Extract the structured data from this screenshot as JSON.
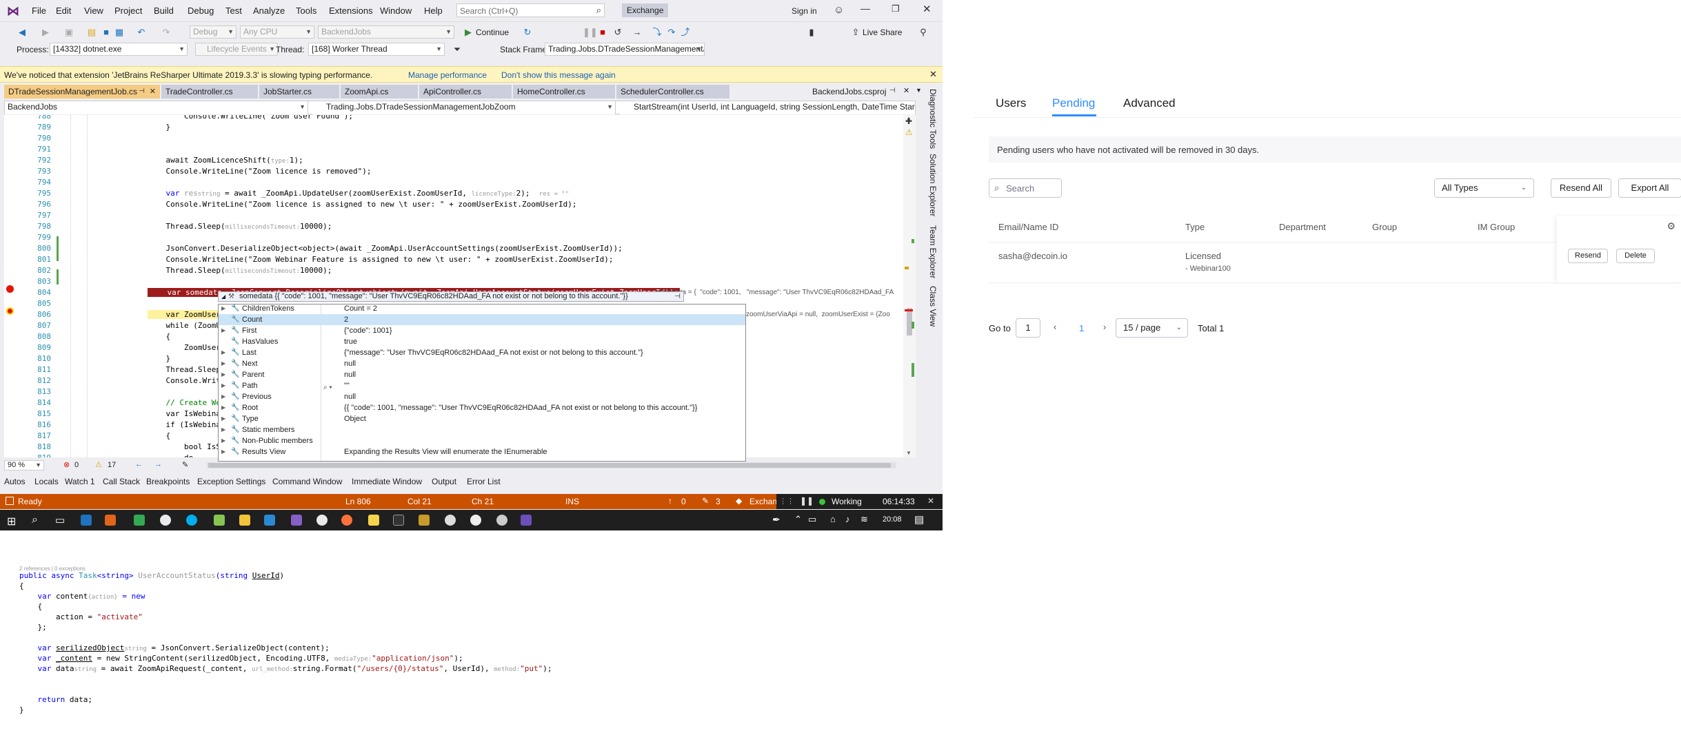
{
  "vs": {
    "menu": [
      "File",
      "Edit",
      "View",
      "Project",
      "Build",
      "Debug",
      "Test",
      "Analyze",
      "Tools",
      "Extensions",
      "Window",
      "Help"
    ],
    "search_placeholder": "Search (Ctrl+Q)",
    "solution_badge": "Exchange",
    "sign_in": "Sign in",
    "toolbar": {
      "config": "Debug",
      "platform": "Any CPU",
      "project": "BackendJobs",
      "continue": "Continue",
      "live_share": "Live Share"
    },
    "toolbar2": {
      "process_label": "Process:",
      "process_value": "[14332] dotnet.exe",
      "lifecycle": "Lifecycle Events",
      "thread_label": "Thread:",
      "thread_value": "[168] Worker Thread",
      "stackframe_label": "Stack Frame:",
      "stackframe_value": "Trading.Jobs.DTradeSessionManagementJ"
    },
    "infobar": {
      "message": "We've noticed that extension 'JetBrains ReSharper Ultimate 2019.3.3' is slowing typing performance.",
      "link1": "Manage performance",
      "link2": "Don't show this message again"
    },
    "tabs": [
      "DTradeSessionManagementJob.cs",
      "TradeController.cs",
      "JobStarter.cs",
      "ZoomApi.cs",
      "ApiController.cs",
      "HomeController.cs",
      "SchedulerController.cs",
      "BackendJobs.csproj"
    ],
    "nav": {
      "project": "BackendJobs",
      "class": "Trading.Jobs.DTradeSessionManagementJobZoom",
      "member": "StartStream(int UserId, int LanguageId, string SessionLength, DateTime StartTi"
    },
    "line_numbers": [
      "788",
      "789",
      "790",
      "791",
      "792",
      "793",
      "794",
      "795",
      "796",
      "797",
      "798",
      "799",
      "800",
      "801",
      "802",
      "803",
      "804",
      "805",
      "806",
      "807",
      "808",
      "809",
      "810",
      "811",
      "812",
      "813",
      "814",
      "815",
      "816",
      "817",
      "818",
      "819",
      "820"
    ],
    "code": {
      "l788": "        Console.WriteLine(\"Zoom user Found\");",
      "l789": "    }",
      "l792": "    await ZoomLicenceShift(",
      "l792_hint": "type:",
      "l792_end": "1);",
      "l793": "    Console.WriteLine(\"Zoom licence is removed\");",
      "l795a": "    var ",
      "l795b": "res",
      "l795_hint1": "string",
      "l795c": " = await _ZoomApi.UpdateUser(zoomUserExist.ZoomUserId, ",
      "l795_hint2": "licenceType:",
      "l795d": "2);",
      "l795_hint3": "res = \"\"",
      "l796": "    Console.WriteLine(\"Zoom licence is assigned to new \\t user: \" + zoomUserExist.ZoomUserId);",
      "l798a": "    Thread.Sleep(",
      "l798_hint": "millisecondsTimeout:",
      "l798b": "10000);",
      "l800": "    JsonConvert.DeserializeObject<object>(await _ZoomApi.UserAccountSettings(zoomUserExist.ZoomUserId));",
      "l801": "    Console.WriteLine(\"Zoom Webinar Feature is assigned to new \\t user: \" + zoomUserExist.ZoomUserId);",
      "l802a": "    Thread.Sleep(",
      "l802_hint": "millisecondsTimeout:",
      "l802b": "10000);",
      "l804": "    var somedata =JsonConvert.DeserializeObject<object>(await _ZoomApi.UserAccountStatus(zoomUserExist.ZoomUserId));",
      "l804_hint": "somedata = {  \"code\": 1001,   \"message\": \"User ThvVC9EqR06c82HDAad_FA",
      "l806": "    var ZoomUserVia",
      "l806_hint": "zoomUserViaApi = null,  zoomUserExist = {Zoo",
      "l807": "    while (ZoomUserV",
      "l808": "    {",
      "l809": "        ZoomUserViaA",
      "l810": "    }",
      "l811": "    Thread.Sleep(",
      "l812": "    Console.WriteLi",
      "l814": "    // Create Webina",
      "l815": "    var IsWebinarEx",
      "l816": "    if (IsWebinarEx",
      "l817": "    {",
      "l818": "        bool IsSucc",
      "l819": "        do",
      "l820": "        {"
    },
    "tooltip": "somedata  {{  \"code\": 1001,   \"message\": \"User ThvVC9EqR06c82HDAad_FA not exist or not belong to this account.\"}}",
    "watch": [
      {
        "name": "ChildrenTokens",
        "value": "Count = 2",
        "expandable": true
      },
      {
        "name": "Count",
        "value": "2",
        "expandable": false
      },
      {
        "name": "First",
        "value": "{\"code\": 1001}",
        "expandable": true
      },
      {
        "name": "HasValues",
        "value": "true",
        "expandable": false
      },
      {
        "name": "Last",
        "value": "{\"message\": \"User ThvVC9EqR06c82HDAad_FA not exist or not belong to this account.\"}",
        "expandable": true
      },
      {
        "name": "Next",
        "value": "null",
        "expandable": true
      },
      {
        "name": "Parent",
        "value": "null",
        "expandable": true
      },
      {
        "name": "Path",
        "value": "\"\"",
        "expandable": true
      },
      {
        "name": "Previous",
        "value": "null",
        "expandable": true
      },
      {
        "name": "Root",
        "value": "{{  \"code\": 1001,   \"message\": \"User ThvVC9EqR06c82HDAad_FA not exist or not belong to this account.\"}}",
        "expandable": true
      },
      {
        "name": "Type",
        "value": "Object",
        "expandable": true
      },
      {
        "name": "Static members",
        "value": "",
        "expandable": true
      },
      {
        "name": "Non-Public members",
        "value": "",
        "expandable": true
      },
      {
        "name": "Results View",
        "value": "Expanding the Results View will enumerate the IEnumerable",
        "expandable": true
      }
    ],
    "zoom_level": "90 %",
    "errors": "0",
    "warnings": "17",
    "right_tabs": [
      "Diagnostic Tools",
      "Solution Explorer",
      "Team Explorer",
      "Class View"
    ],
    "bottom_tabs": [
      "Autos",
      "Locals",
      "Watch 1",
      "Call Stack",
      "Breakpoints",
      "Exception Settings",
      "Command Window",
      "Immediate Window",
      "Output",
      "Error List"
    ],
    "status": {
      "ready": "Ready",
      "ln": "Ln 806",
      "col": "Col 21",
      "ch": "Ch 21",
      "ins": "INS",
      "up": "0",
      "pencil": "3",
      "branch": "Exchan",
      "working": "Working",
      "timer": "06:14:33"
    },
    "taskbar_time": "20:08"
  },
  "snippet": {
    "refs": "2 references | 0 exceptions",
    "l1a": "public async ",
    "l1b": "Task",
    "l1c": "<string> ",
    "l1d": "UserAccountStatus",
    "l1e": "(string ",
    "l1f": "UserId",
    "l1g": ")",
    "l2": "{",
    "l3a": "    var ",
    "l3b": "content",
    "l3_hint": "{action}",
    "l3c": " = new",
    "l4": "    {",
    "l5a": "        action = ",
    "l5b": "\"activate\"",
    "l6": "    };",
    "l8a": "    var ",
    "l8b": "serilizedObject",
    "l8_hint": "string",
    "l8c": " = JsonConvert.SerializeObject(content);",
    "l9a": "    var ",
    "l9b": "_content",
    "l9c": " = new StringContent(serilizedObject, Encoding.UTF8, ",
    "l9_hint": "mediaType:",
    "l9d": "\"application/json\"",
    "l9e": ");",
    "l10a": "    var ",
    "l10b": "data",
    "l10_hint1": "string",
    "l10c": " = await ZoomApiRequest(_content, ",
    "l10_hint2": "url_method:",
    "l10d": "string.Format(",
    "l10e": "\"/users/{0}/status\"",
    "l10f": ", UserId), ",
    "l10_hint3": "method:",
    "l10g": "\"put\"",
    "l10h": ");",
    "l12a": "    return ",
    "l12b": "data;",
    "l13": "}"
  },
  "zoom": {
    "tabs": [
      "Users",
      "Pending",
      "Advanced"
    ],
    "notice": "Pending users who have not activated will be removed in 30 days.",
    "search_placeholder": "Search",
    "type_filter": "All Types",
    "resend_all": "Resend All",
    "export_all": "Export All",
    "columns": [
      "Email/Name ID",
      "Type",
      "Department",
      "Group",
      "IM Group"
    ],
    "row": {
      "email": "sasha@decoin.io",
      "type": "Licensed",
      "sub": "- Webinar100"
    },
    "resend": "Resend",
    "delete": "Delete",
    "pagination": {
      "goto": "Go to",
      "goto_value": "1",
      "current": "1",
      "per_page": "15 / page",
      "total": "Total 1"
    }
  }
}
